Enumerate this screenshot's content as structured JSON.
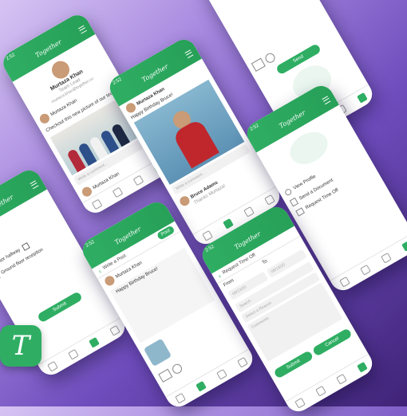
{
  "brand": "Together",
  "time": "2:52",
  "profile": {
    "name": "Murtaza Khan",
    "role": "Team Lead",
    "email": "murtaza.khan@together.co",
    "post_author": "Murtaza Khan",
    "post_text": "Checkout this new picture of our team",
    "comment_placeholder": "Write a comment...",
    "footer_author": "Murtaza Khan"
  },
  "birthday": {
    "author": "Murtaza Khan",
    "text": "Happy Birthday Bruce!",
    "reply_author": "Bruce Adams",
    "reply_text": "Thanks Murtaza!"
  },
  "send": {
    "send_label": "Send"
  },
  "menu": {
    "items": [
      "View Profile",
      "Send a Document",
      "Request Time Off"
    ]
  },
  "qr": {
    "items": [
      "First floor hallway",
      "Ground floor reception"
    ],
    "submit_label": "Submit"
  },
  "write": {
    "title": "Write a Post",
    "post_label": "Post",
    "author": "Murtaza Khan",
    "text": "Happy Birthday Bruce!"
  },
  "timeoff": {
    "title": "Request Time Off",
    "from_label": "From",
    "to_label": "To",
    "from_date": "09/13/20",
    "to_date": "09/13/20",
    "search_placeholder": "Search",
    "reason_placeholder": "Select a Reason",
    "comments_placeholder": "Comments",
    "submit_label": "Submit",
    "cancel_label": "Cancel"
  },
  "logo_letter": "T"
}
